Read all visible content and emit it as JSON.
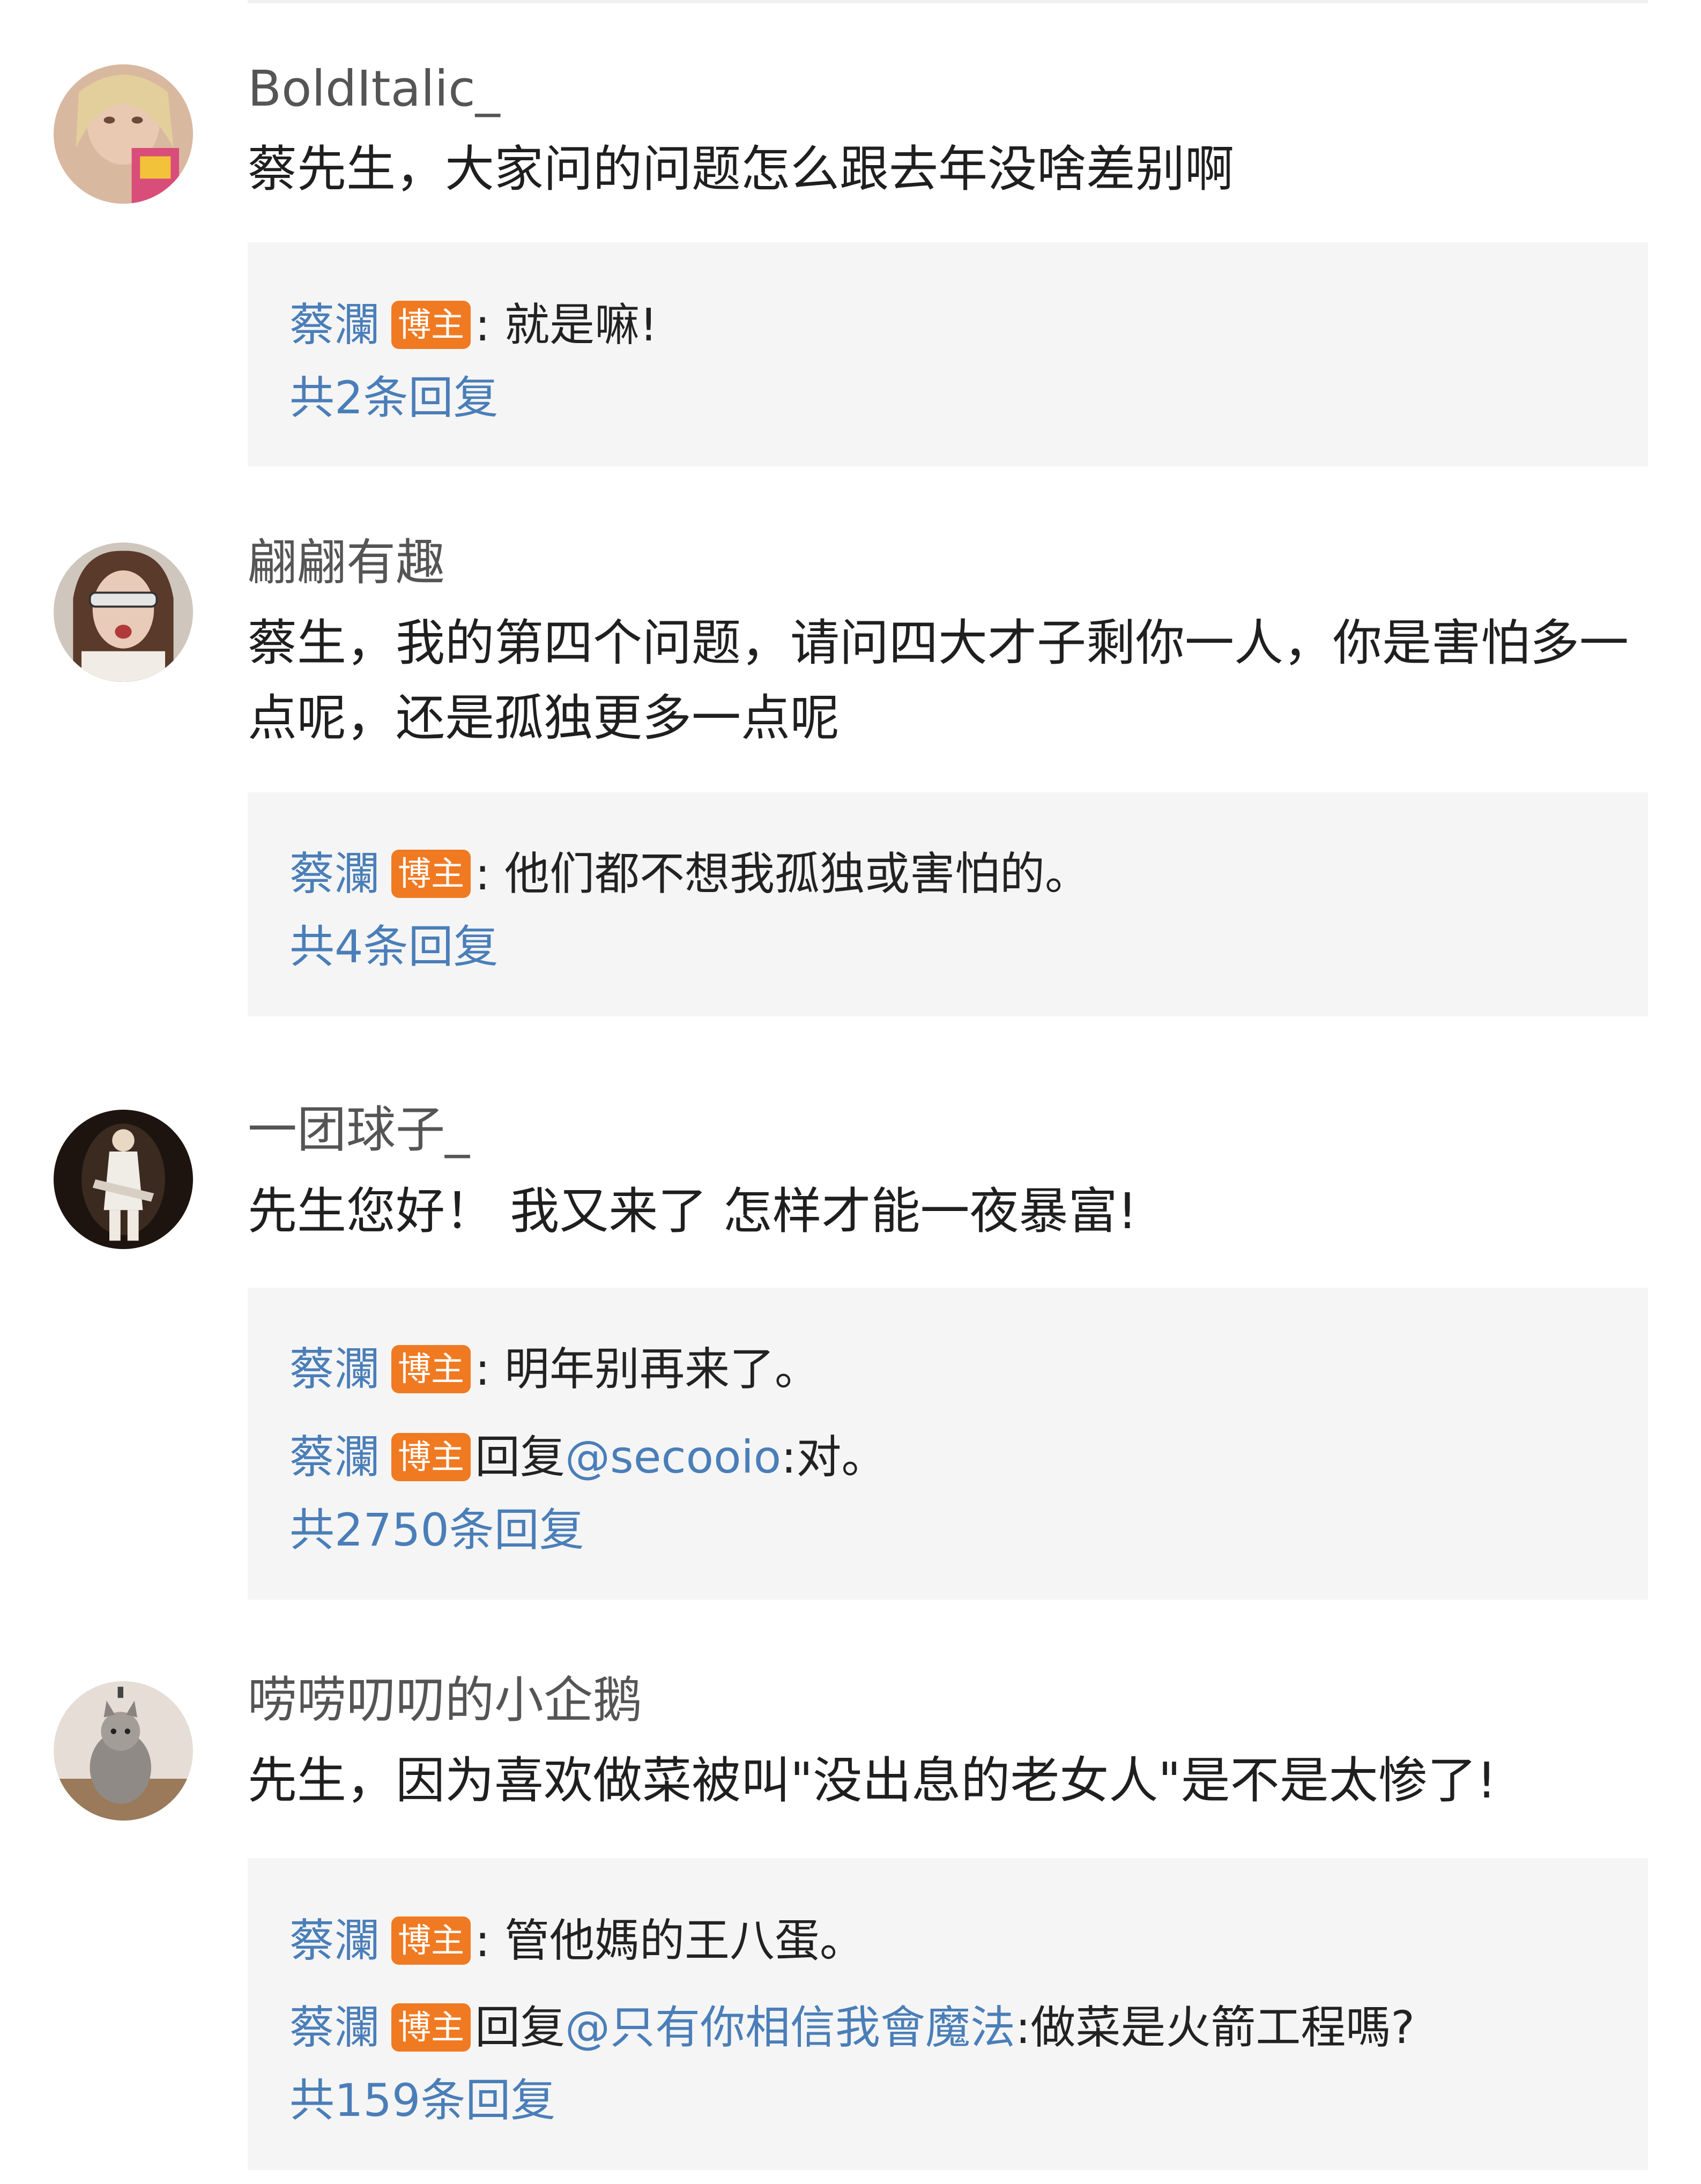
{
  "comments": [
    {
      "username": "BoldItalic_",
      "text": "蔡先生，大家问的问题怎么跟去年没啥差别啊",
      "replies": [
        {
          "author": "蔡瀾",
          "badge": "博主",
          "sep": ":",
          "prefix": "",
          "mention": "",
          "text": " 就是嘛!"
        }
      ],
      "reply_count": "共2条回复"
    },
    {
      "username": "翩翩有趣",
      "text": "蔡生，我的第四个问题，请问四大才子剩你一人，你是害怕多一点呢，还是孤独更多一点呢",
      "replies": [
        {
          "author": "蔡瀾",
          "badge": "博主",
          "sep": ":",
          "prefix": "",
          "mention": "",
          "text": " 他们都不想我孤独或害怕的。"
        }
      ],
      "reply_count": "共4条回复"
    },
    {
      "username": "一团球子_",
      "text": "先生您好！ 我又来了 怎样才能一夜暴富!",
      "replies": [
        {
          "author": "蔡瀾",
          "badge": "博主",
          "sep": ":",
          "prefix": "",
          "mention": "",
          "text": " 明年别再来了。"
        },
        {
          "author": "蔡瀾",
          "badge": "博主",
          "sep": "",
          "prefix": "回复",
          "mention": "@secooio",
          "text": ":对。"
        }
      ],
      "reply_count": "共2750条回复"
    },
    {
      "username": "唠唠叨叨的小企鹅",
      "text": "先生，因为喜欢做菜被叫\"没出息的老女人\"是不是太惨了!",
      "replies": [
        {
          "author": "蔡瀾",
          "badge": "博主",
          "sep": ":",
          "prefix": "",
          "mention": "",
          "text": " 管他媽的王八蛋。"
        },
        {
          "author": "蔡瀾",
          "badge": "博主",
          "sep": "",
          "prefix": "回复",
          "mention": "@只有你相信我會魔法",
          "text": ":做菜是火箭工程嗎?"
        }
      ],
      "reply_count": "共159条回复"
    }
  ],
  "icons": {
    "avatar_1": "avatar-photo-blonde-woman",
    "avatar_2": "avatar-photo-woman-sunglasses",
    "avatar_3": "avatar-photo-guitarist",
    "avatar_4": "avatar-photo-cat"
  },
  "colors": {
    "author_link": "#4a7eb8",
    "badge_bg": "#f07a22",
    "reply_bg": "#f5f5f5"
  }
}
